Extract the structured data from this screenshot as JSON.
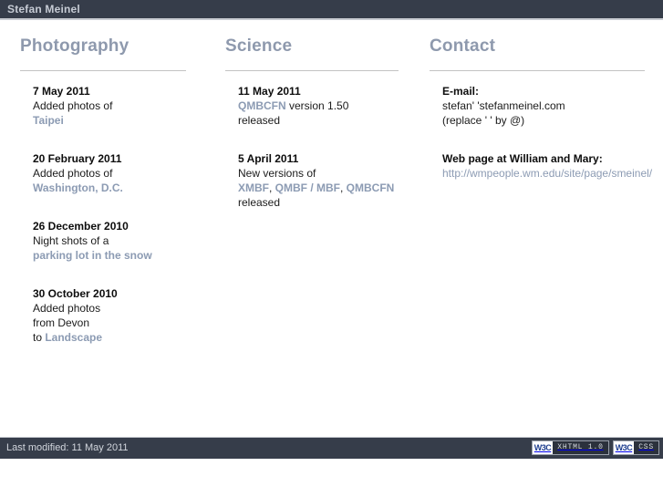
{
  "header": {
    "site_title": "Stefan Meinel"
  },
  "columns": [
    {
      "id": "photography",
      "heading": "Photography",
      "entries": [
        {
          "date": "7 May 2011",
          "lines": [
            {
              "text": "Added photos of",
              "link": false
            },
            {
              "text": "Taipei",
              "link": true
            }
          ]
        },
        {
          "date": "20 February 2011",
          "lines": [
            {
              "text": "Added photos of",
              "link": false
            },
            {
              "text": "Washington, D.C.",
              "link": true
            }
          ]
        },
        {
          "date": "26 December 2010",
          "lines": [
            {
              "text": "Night shots of a",
              "link": false
            },
            {
              "text": "parking lot in the snow",
              "link": true
            }
          ]
        },
        {
          "date": "30 October 2010",
          "lines": [
            {
              "text": "Added photos",
              "link": false
            },
            {
              "text": "from Devon",
              "link": false
            },
            {
              "prefix": "to ",
              "text": "Landscape",
              "link": true
            }
          ]
        }
      ]
    },
    {
      "id": "science",
      "heading": "Science",
      "entries": [
        {
          "date": "11 May 2011",
          "lines": [
            {
              "text": "QMBCFN",
              "link": true,
              "suffix": " version 1.50"
            },
            {
              "text": "released",
              "link": false
            }
          ]
        },
        {
          "date": "5 April 2011",
          "lines": [
            {
              "text": "New versions of",
              "link": false
            },
            {
              "parts": [
                {
                  "text": "XMBF",
                  "link": true
                },
                {
                  "text": ", ",
                  "link": false
                },
                {
                  "text": "QMBF / MBF",
                  "link": true
                },
                {
                  "text": ", ",
                  "link": false
                },
                {
                  "text": "QMBCFN",
                  "link": true
                }
              ]
            },
            {
              "text": "released",
              "link": false
            }
          ]
        }
      ]
    }
  ],
  "contact": {
    "heading": "Contact",
    "email_label": "E-mail:",
    "email_value": "stefan' 'stefanmeinel.com",
    "email_note": "(replace ' ' by @)",
    "webpage_label": "Web page at William and Mary:",
    "webpage_url": "http://wmpeople.wm.edu/site/page/smeinel/"
  },
  "footer": {
    "last_modified": "Last modified: 11 May 2011",
    "badges": [
      {
        "mark": "W3C",
        "text": "XHTML 1.0"
      },
      {
        "mark": "W3C",
        "text": "CSS"
      }
    ]
  },
  "colors": {
    "bar_background": "#363d4a",
    "heading": "#8e99ad",
    "link": "#8c9bb3",
    "rule": "#c3c3c3",
    "text": "#1b1b1b",
    "bar_text": "#c6cbd4",
    "page_background": "#ffffff"
  }
}
